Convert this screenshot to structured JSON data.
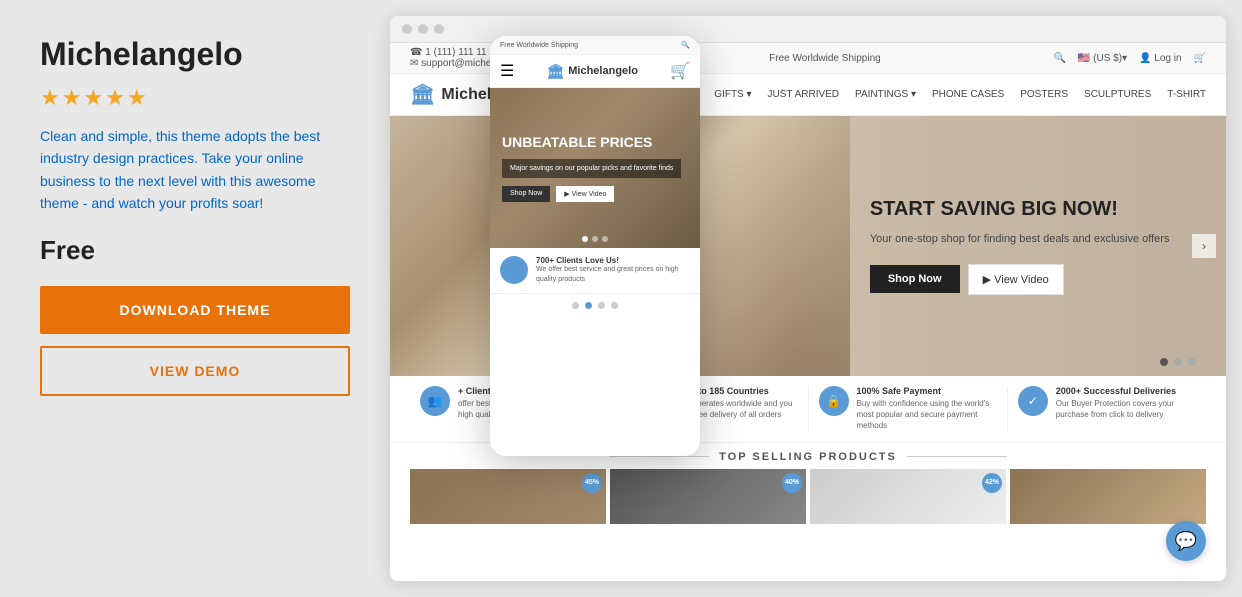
{
  "left": {
    "title": "Michelangelo",
    "stars": "★★★★★",
    "description": "Clean and simple, this theme adopts the best industry design practices. Take your online business to the next level with this awesome theme - and watch your profits soar!",
    "price": "Free",
    "download_btn": "DOWNLOAD THEME",
    "demo_btn": "VIEW DEMO"
  },
  "store": {
    "topbar": {
      "phone": "☎ 1 (111) 111 11 11",
      "email": "✉ support@michelangelo.alldropship.com",
      "shipping": "Free Worldwide Shipping",
      "flag": "🇺🇸 (US $)▾",
      "login": "👤 Log in",
      "cart": "🛒"
    },
    "logo": "Michelangelo",
    "nav_items": [
      "GIFTS ▾",
      "JUST ARRIVED",
      "PAINTINGS ▾",
      "PHONE CASES",
      "POSTERS",
      "SCULPTURES",
      "T-SHIRT"
    ],
    "hero": {
      "headline": "START SAVING BIG NOW!",
      "subtext": "Your one-stop shop for finding best deals and exclusive offers",
      "shop_btn": "Shop Now",
      "video_btn": "▶ View Video"
    },
    "mobile_hero": {
      "headline": "UNBEATABLE PRICES",
      "desc": "Major savings on our popular picks and favorite finds",
      "shop_btn": "Shop Now",
      "video_btn": "▶ View Video"
    },
    "features": [
      {
        "title": "+ Clients Love Us!",
        "text": "offer best service and best prices on high quality products"
      },
      {
        "title": "Shipping to 185 Countries",
        "text": "Our store operates worldwide and you can enjoy free delivery of all orders"
      },
      {
        "title": "100% Safe Payment",
        "text": "Buy with confidence using the world's most popular and secure payment methods"
      },
      {
        "title": "2000+ Successful Deliveries",
        "text": "Our Buyer Protection covers your purchase from click to delivery"
      }
    ],
    "mobile_feature": {
      "title": "700+ Clients Love Us!",
      "text": "We offer best service and great prices on high quality products"
    },
    "top_selling": "TOP SELLING PRODUCTS",
    "badges": [
      "45%",
      "40%",
      "42%",
      ""
    ]
  }
}
